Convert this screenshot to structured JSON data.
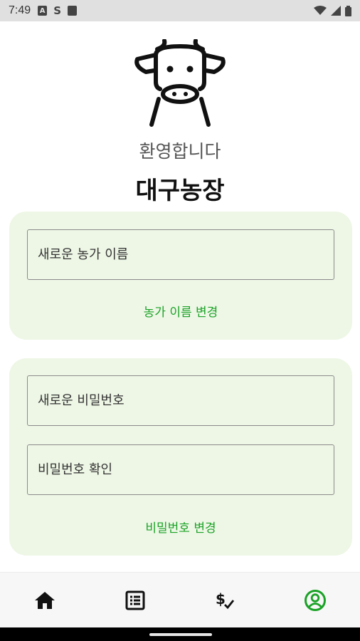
{
  "status_bar": {
    "time": "7:49"
  },
  "header": {
    "welcome": "환영합니다",
    "farm_name": "대구농장"
  },
  "farm_name_card": {
    "name_placeholder": "새로운 농가 이름",
    "change_label": "농가 이름 변경"
  },
  "password_card": {
    "new_password_placeholder": "새로운 비밀번호",
    "confirm_password_placeholder": "비밀번호 확인",
    "change_label": "비밀번호 변경"
  },
  "bottom_nav": {
    "items": [
      {
        "icon": "home-icon",
        "active": false
      },
      {
        "icon": "list-icon",
        "active": false
      },
      {
        "icon": "payment-check-icon",
        "active": false
      },
      {
        "icon": "account-icon",
        "active": true
      }
    ]
  },
  "colors": {
    "accent": "#1aa226",
    "card_bg": "#eef7e6"
  }
}
